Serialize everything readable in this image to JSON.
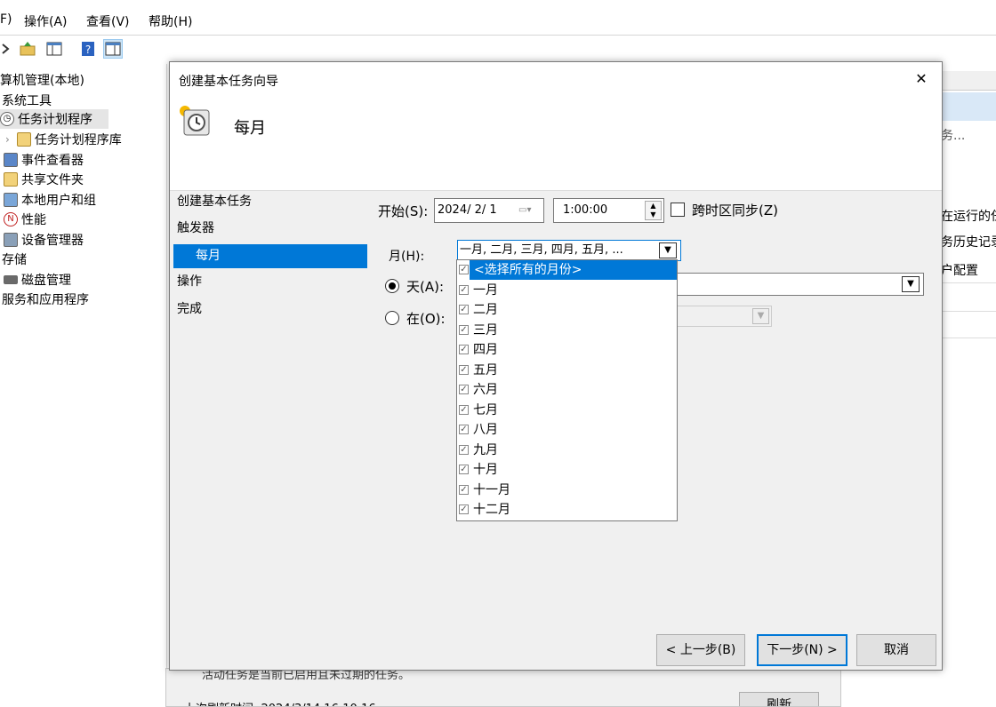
{
  "menu": {
    "file": "F)",
    "action": "操作(A)",
    "view": "查看(V)",
    "help": "帮助(H)"
  },
  "tree": {
    "root": "算机管理(本地)",
    "items": [
      {
        "label": "系统工具",
        "icon": "tools-icon"
      },
      {
        "label": "任务计划程序",
        "icon": "clock-icon"
      },
      {
        "label": "任务计划程序库",
        "icon": "folder-clock-icon"
      },
      {
        "label": "事件查看器",
        "icon": "event-viewer-icon"
      },
      {
        "label": "共享文件夹",
        "icon": "shared-folder-icon"
      },
      {
        "label": "本地用户和组",
        "icon": "users-icon"
      },
      {
        "label": "性能",
        "icon": "performance-icon"
      },
      {
        "label": "设备管理器",
        "icon": "device-manager-icon"
      },
      {
        "label": "存储",
        "icon": ""
      },
      {
        "label": "磁盘管理",
        "icon": "disk-icon"
      },
      {
        "label": "服务和应用程序",
        "icon": ""
      }
    ]
  },
  "right_panel": {
    "line1": "务...",
    "line2": "在运行的任",
    "line3": "务历史记录",
    "line4": "户配置"
  },
  "bottom": {
    "text1": "活动任务是当前已启用且未过期的任务。",
    "last_refresh": "上次刷新时间: 2024/3/14 16:10:16",
    "refresh": "刷新"
  },
  "dialog": {
    "title": "创建基本任务向导",
    "close": "✕",
    "heading": "每月",
    "steps": [
      "创建基本任务",
      "触发器",
      "每月",
      "操作",
      "完成"
    ],
    "start_label": "开始(S):",
    "start_date": "2024/  2/  1",
    "start_time": "1:00:00",
    "sync_label": "跨时区同步(Z)",
    "month_label": "月(H):",
    "month_value": "一月, 二月, 三月, 四月, 五月, ...",
    "day_label": "天(A):",
    "on_label": "在(O):",
    "back": "< 上一步(B)",
    "next": "下一步(N) >",
    "cancel": "取消"
  },
  "dropdown": {
    "items": [
      "<选择所有的月份>",
      "一月",
      "二月",
      "三月",
      "四月",
      "五月",
      "六月",
      "七月",
      "八月",
      "九月",
      "十月",
      "十一月",
      "十二月"
    ],
    "highlighted": 0
  }
}
